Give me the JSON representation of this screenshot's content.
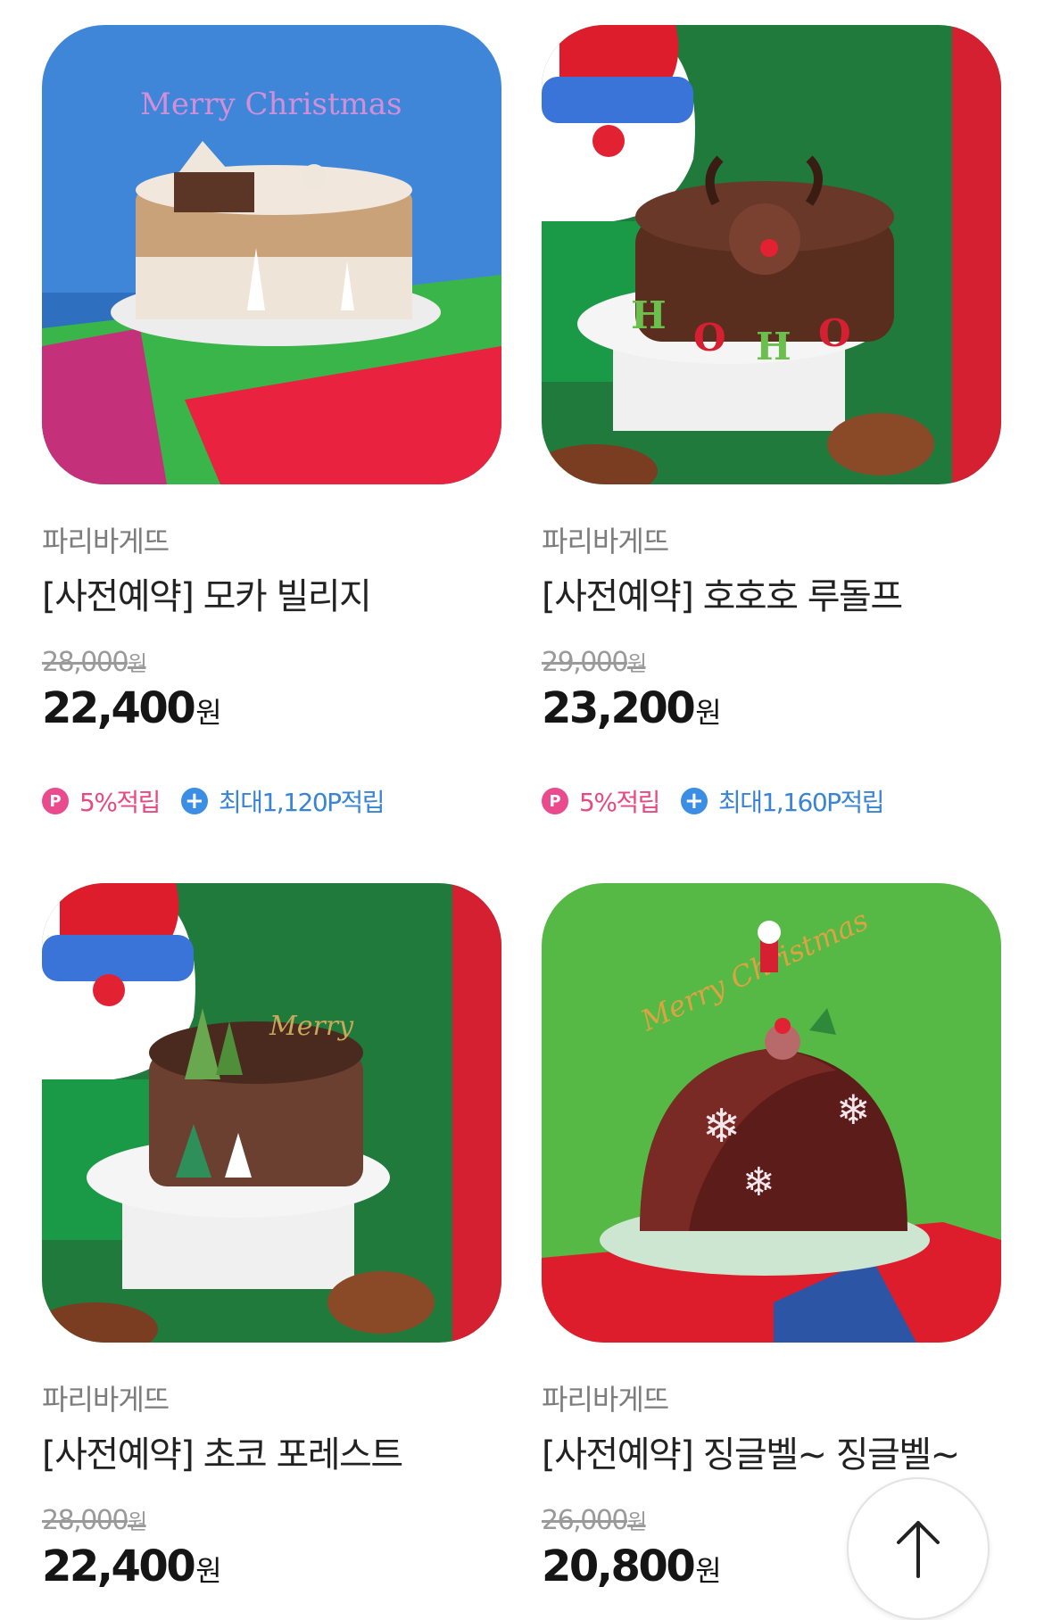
{
  "products": [
    {
      "brand": "파리바게뜨",
      "name": "[사전예약] 모카 빌리지",
      "original_price": "28,000",
      "original_currency": "원",
      "price": "22,400",
      "currency": "원",
      "point_badge": "P",
      "point_rate": "5%적립",
      "max_point": "최대1,120P적립",
      "image_desc": "mocha-village-cake-image"
    },
    {
      "brand": "파리바게뜨",
      "name": "[사전예약] 호호호 루돌프",
      "original_price": "29,000",
      "original_currency": "원",
      "price": "23,200",
      "currency": "원",
      "point_badge": "P",
      "point_rate": "5%적립",
      "max_point": "최대1,160P적립",
      "image_desc": "hohoho-rudolph-cake-image"
    },
    {
      "brand": "파리바게뜨",
      "name": "[사전예약] 초코 포레스트",
      "original_price": "28,000",
      "original_currency": "원",
      "price": "22,400",
      "currency": "원",
      "image_desc": "choco-forest-cake-image"
    },
    {
      "brand": "파리바게뜨",
      "name": "[사전예약] 징글벨~ 징글벨~",
      "original_price": "26,000",
      "original_currency": "원",
      "price": "20,800",
      "currency": "원",
      "image_desc": "jingle-bell-cake-image"
    }
  ],
  "scroll_top_icon": "arrow-up-icon",
  "colors": {
    "point_pink": "#ea4b8c",
    "point_blue": "#3b8ee3"
  }
}
